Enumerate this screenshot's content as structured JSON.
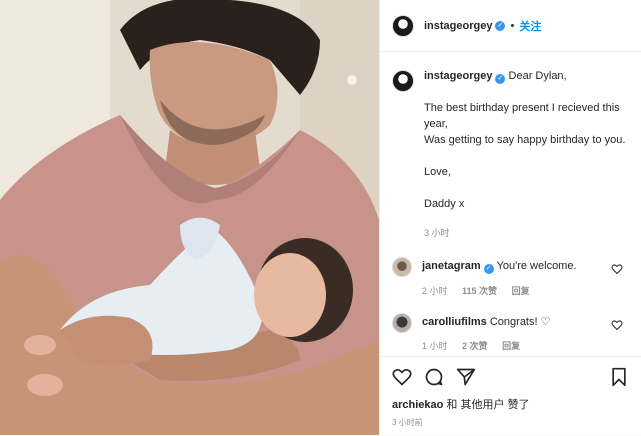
{
  "post": {
    "username": "instageorgey",
    "follow_label": "关注",
    "separator": "•"
  },
  "caption": {
    "username": "instageorgey",
    "lines": [
      "Dear Dylan,",
      "The best birthday present I recieved this year,",
      "Was getting to say happy birthday to you.",
      "Love,",
      "Daddy x"
    ],
    "time": "3 小时"
  },
  "comments": [
    {
      "username": "janetagram",
      "text": "You're welcome.",
      "time": "2 小时",
      "likes": "115 次赞",
      "reply": "回复"
    },
    {
      "username": "carolliufilms",
      "text": "Congrats! ♡",
      "time": "1 小时",
      "likes": "2 次赞",
      "reply": "回复"
    }
  ],
  "actions": {
    "icons": [
      "heart-icon",
      "comment-icon",
      "share-icon",
      "bookmark-icon"
    ],
    "likes_user": "archiekao",
    "likes_rest": " 和 其他用户 赞了",
    "time_ago": "3 小时前"
  },
  "colors": {
    "accent": "#0095f6",
    "verified": "#3897f0",
    "muted": "#8e8e8e"
  }
}
